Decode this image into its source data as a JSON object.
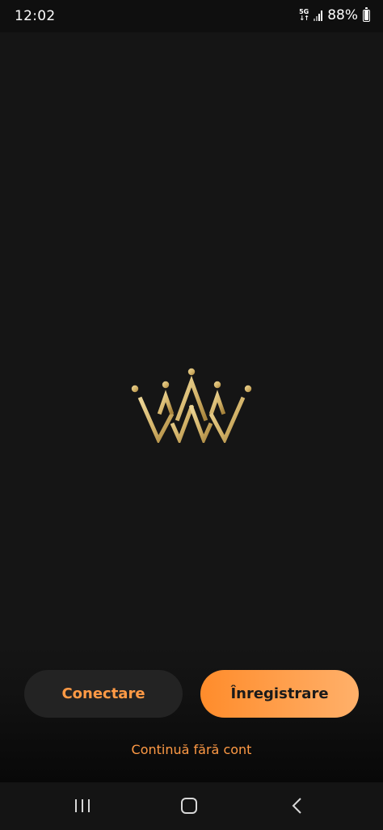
{
  "status_bar": {
    "time": "12:02",
    "network": "5G",
    "battery": "88%"
  },
  "logo": {
    "icon": "crown-icon",
    "colors": {
      "gold_light": "#e8cf8c",
      "gold_dark": "#a8843c"
    }
  },
  "actions": {
    "login_label": "Conectare",
    "register_label": "Înregistrare",
    "guest_label": "Continuă fără cont"
  },
  "colors": {
    "background": "#151515",
    "accent": "#ff9a45",
    "accent_gradient_start": "#ff8c2b",
    "accent_gradient_end": "#ffb06a",
    "login_button_bg": "#232323"
  },
  "nav_bar": {
    "recents_icon": "recents-icon",
    "home_icon": "home-icon",
    "back_icon": "back-icon"
  }
}
